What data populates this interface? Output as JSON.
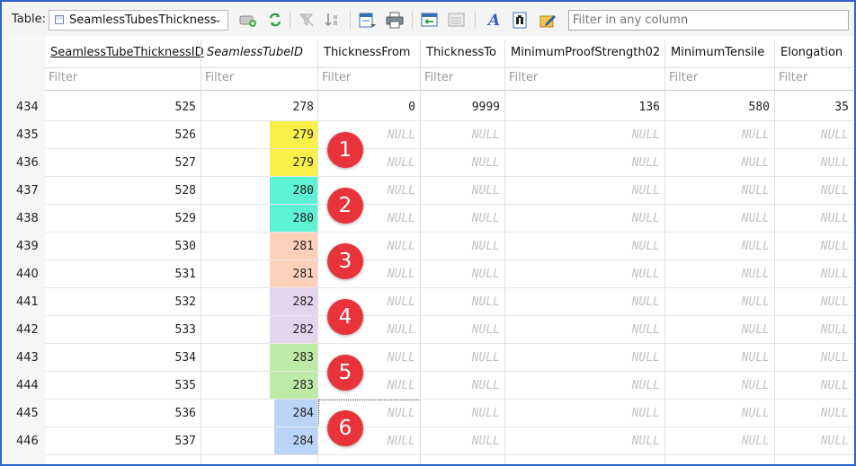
{
  "toolbar": {
    "table_label": "Table:",
    "selected_table": "SeamlessTubesThickness",
    "filter_any_placeholder": "Filter in any column"
  },
  "grid": {
    "columns": [
      {
        "key": "id",
        "label": "SeamlessTubeThicknessID",
        "filter": "Filter"
      },
      {
        "key": "tube",
        "label": "SeamlessTubeID",
        "filter": "Filter"
      },
      {
        "key": "from",
        "label": "ThicknessFrom",
        "filter": "Filter"
      },
      {
        "key": "to",
        "label": "ThicknessTo",
        "filter": "Filter"
      },
      {
        "key": "proof",
        "label": "MinimumProofStrength02",
        "filter": "Filter"
      },
      {
        "key": "tensile",
        "label": "MinimumTensile",
        "filter": "Filter"
      },
      {
        "key": "elong",
        "label": "Elongation",
        "filter": "Filter"
      }
    ],
    "rows": [
      {
        "rownum": "434",
        "id": "525",
        "tube": "278",
        "from": "0",
        "to": "9999",
        "proof": "136",
        "tensile": "580",
        "elong": "35"
      },
      {
        "rownum": "435",
        "id": "526",
        "tube": "279",
        "from": "NULL",
        "to": "NULL",
        "proof": "NULL",
        "tensile": "NULL",
        "elong": "NULL"
      },
      {
        "rownum": "436",
        "id": "527",
        "tube": "279",
        "from": "NULL",
        "to": "NULL",
        "proof": "NULL",
        "tensile": "NULL",
        "elong": "NULL"
      },
      {
        "rownum": "437",
        "id": "528",
        "tube": "280",
        "from": "NULL",
        "to": "NULL",
        "proof": "NULL",
        "tensile": "NULL",
        "elong": "NULL"
      },
      {
        "rownum": "438",
        "id": "529",
        "tube": "280",
        "from": "NULL",
        "to": "NULL",
        "proof": "NULL",
        "tensile": "NULL",
        "elong": "NULL"
      },
      {
        "rownum": "439",
        "id": "530",
        "tube": "281",
        "from": "NULL",
        "to": "NULL",
        "proof": "NULL",
        "tensile": "NULL",
        "elong": "NULL"
      },
      {
        "rownum": "440",
        "id": "531",
        "tube": "281",
        "from": "NULL",
        "to": "NULL",
        "proof": "NULL",
        "tensile": "NULL",
        "elong": "NULL"
      },
      {
        "rownum": "441",
        "id": "532",
        "tube": "282",
        "from": "NULL",
        "to": "NULL",
        "proof": "NULL",
        "tensile": "NULL",
        "elong": "NULL"
      },
      {
        "rownum": "442",
        "id": "533",
        "tube": "282",
        "from": "NULL",
        "to": "NULL",
        "proof": "NULL",
        "tensile": "NULL",
        "elong": "NULL"
      },
      {
        "rownum": "443",
        "id": "534",
        "tube": "283",
        "from": "NULL",
        "to": "NULL",
        "proof": "NULL",
        "tensile": "NULL",
        "elong": "NULL"
      },
      {
        "rownum": "444",
        "id": "535",
        "tube": "283",
        "from": "NULL",
        "to": "NULL",
        "proof": "NULL",
        "tensile": "NULL",
        "elong": "NULL"
      },
      {
        "rownum": "445",
        "id": "536",
        "tube": "284",
        "from": "NULL",
        "to": "NULL",
        "proof": "NULL",
        "tensile": "NULL",
        "elong": "NULL"
      },
      {
        "rownum": "446",
        "id": "537",
        "tube": "284",
        "from": "NULL",
        "to": "NULL",
        "proof": "NULL",
        "tensile": "NULL",
        "elong": "NULL"
      }
    ]
  },
  "annotations": [
    {
      "label": "1",
      "color": "#f9f04a"
    },
    {
      "label": "2",
      "color": "#5cf2d3"
    },
    {
      "label": "3",
      "color": "#fdd0bb"
    },
    {
      "label": "4",
      "color": "#e3d6ec"
    },
    {
      "label": "5",
      "color": "#bdeba7"
    },
    {
      "label": "6",
      "color": "#bad4f5"
    }
  ],
  "colors": {
    "frame_border": "#2f63c8",
    "badge_red": "#e8333a",
    "null_text": "#c2c2c2"
  },
  "icons": [
    "table-icon",
    "add-record-icon",
    "refresh-icon",
    "clear-filter-icon",
    "sort-icon",
    "export-icon",
    "print-icon",
    "import-icon",
    "report-icon",
    "font-icon",
    "find-icon",
    "edit-icon"
  ]
}
